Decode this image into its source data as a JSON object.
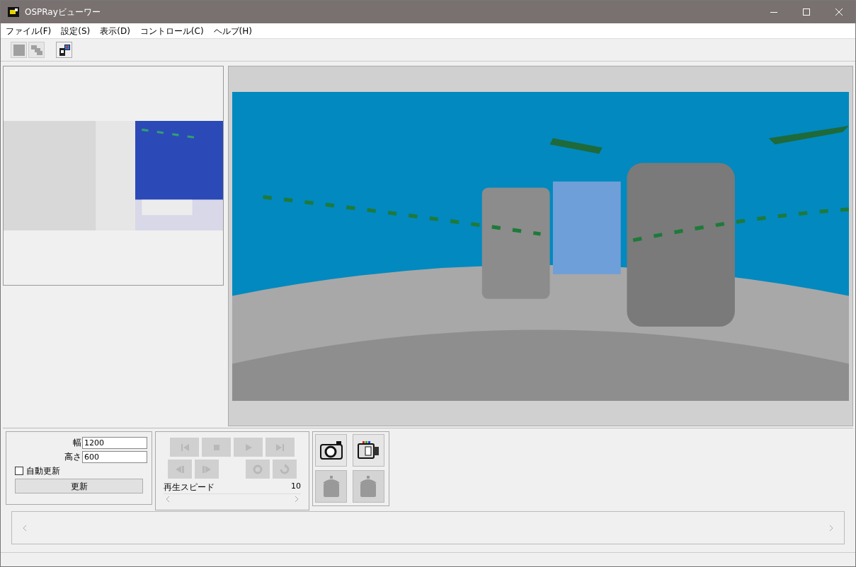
{
  "window": {
    "title": "OSPRayビューワー"
  },
  "menu": [
    {
      "label": "ファイル(F)"
    },
    {
      "label": "設定(S)"
    },
    {
      "label": "表示(D)"
    },
    {
      "label": "コントロール(C)"
    },
    {
      "label": "ヘルプ(H)"
    }
  ],
  "toolbar": [
    {
      "kind": "square",
      "disabled": true
    },
    {
      "kind": "tiles",
      "disabled": true
    },
    {
      "kind": "device",
      "disabled": false
    }
  ],
  "size_panel": {
    "width_label": "幅",
    "width_value": "1200",
    "height_label": "高さ",
    "height_value": "600",
    "auto_update": {
      "label": "自動更新",
      "checked": false
    },
    "update_button": "更新"
  },
  "playback": {
    "buttons": [
      {
        "kind": "first",
        "disabled": true
      },
      {
        "kind": "stop",
        "disabled": true
      },
      {
        "kind": "play",
        "disabled": true
      },
      {
        "kind": "last",
        "disabled": true
      },
      {
        "kind": "step_back",
        "disabled": true
      },
      {
        "kind": "step_forward",
        "disabled": true
      },
      {
        "kind": "reload",
        "disabled": true
      },
      {
        "kind": "rotate",
        "disabled": true
      }
    ],
    "speed_label": "再生スピード",
    "speed_value": "10"
  },
  "capture": [
    {
      "kind": "camera",
      "disabled": false
    },
    {
      "kind": "video",
      "disabled": false
    },
    {
      "kind": "pot",
      "disabled": true
    },
    {
      "kind": "pot",
      "disabled": true
    }
  ]
}
